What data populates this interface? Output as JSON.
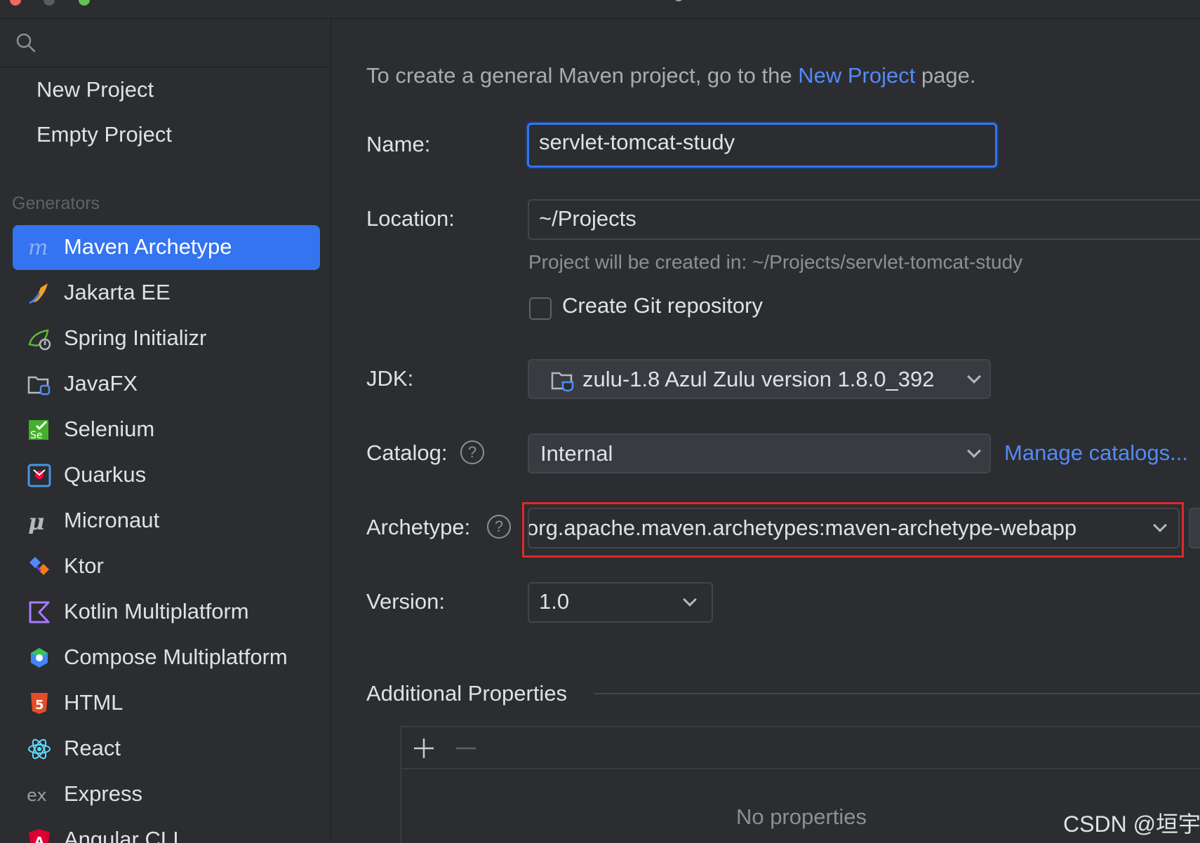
{
  "window": {
    "title": "New Project"
  },
  "sidebar": {
    "top_items": [
      {
        "label": "New Project"
      },
      {
        "label": "Empty Project"
      }
    ],
    "section_label": "Generators",
    "generators": [
      {
        "label": "Maven Archetype",
        "icon": "maven-icon",
        "selected": true
      },
      {
        "label": "Jakarta EE",
        "icon": "jakarta-icon"
      },
      {
        "label": "Spring Initializr",
        "icon": "spring-icon"
      },
      {
        "label": "JavaFX",
        "icon": "javafx-icon"
      },
      {
        "label": "Selenium",
        "icon": "selenium-icon"
      },
      {
        "label": "Quarkus",
        "icon": "quarkus-icon"
      },
      {
        "label": "Micronaut",
        "icon": "micronaut-icon"
      },
      {
        "label": "Ktor",
        "icon": "ktor-icon"
      },
      {
        "label": "Kotlin Multiplatform",
        "icon": "kotlin-icon"
      },
      {
        "label": "Compose Multiplatform",
        "icon": "compose-icon"
      },
      {
        "label": "HTML",
        "icon": "html5-icon"
      },
      {
        "label": "React",
        "icon": "react-icon"
      },
      {
        "label": "Express",
        "icon": "express-icon"
      },
      {
        "label": "Angular CLI",
        "icon": "angular-icon"
      }
    ]
  },
  "main": {
    "intro": {
      "before": "To create a general Maven project, go to the ",
      "link": "New Project",
      "after": " page."
    },
    "name": {
      "label": "Name:",
      "value": "servlet-tomcat-study"
    },
    "location": {
      "label": "Location:",
      "value": "~/Projects",
      "hint": "Project will be created in: ~/Projects/servlet-tomcat-study"
    },
    "git": {
      "label": "Create Git repository",
      "checked": false
    },
    "jdk": {
      "label": "JDK:",
      "value": "zulu-1.8 Azul Zulu version 1.8.0_392"
    },
    "catalog": {
      "label": "Catalog:",
      "value": "Internal",
      "manage_link": "Manage catalogs..."
    },
    "archetype": {
      "label": "Archetype:",
      "value": "org.apache.maven.archetypes:maven-archetype-webapp"
    },
    "version": {
      "label": "Version:",
      "value": "1.0"
    },
    "additional": {
      "title": "Additional Properties",
      "empty_text": "No properties"
    }
  },
  "watermark": "CSDN @垣宇",
  "colors": {
    "accent": "#3574f0",
    "link": "#548af7",
    "background": "#2b2d30",
    "highlight_box": "#e0282a"
  }
}
